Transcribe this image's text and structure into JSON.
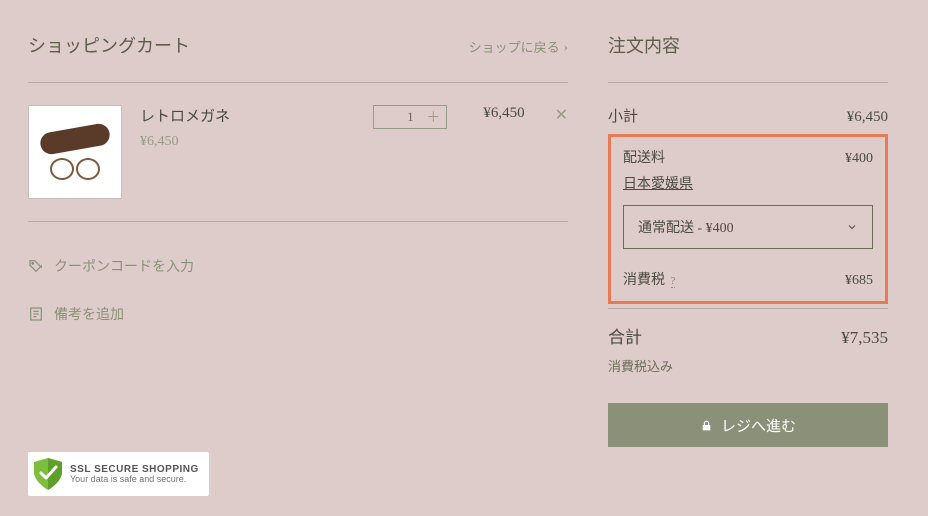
{
  "header": {
    "cart_title": "ショッピングカート",
    "back_to_shop": "ショップに戻る"
  },
  "item": {
    "name": "レトロメガネ",
    "unit_price": "¥6,450",
    "qty": "1",
    "line_total": "¥6,450"
  },
  "actions": {
    "coupon": "クーポンコードを入力",
    "note": "備考を追加"
  },
  "order": {
    "title": "注文内容",
    "subtotal_label": "小計",
    "subtotal_value": "¥6,450",
    "shipping_label": "配送料",
    "shipping_value": "¥400",
    "destination": "日本愛媛県",
    "shipping_option": "通常配送 - ¥400",
    "tax_label": "消費税",
    "tax_help": "?",
    "tax_value": "¥685",
    "total_label": "合計",
    "total_value": "¥7,535",
    "tax_note": "消費税込み",
    "checkout": "レジへ進む"
  },
  "ssl": {
    "line1_prefix": "SSL",
    "line1_main": "SECURE SHOPPING",
    "line2": "Your data is safe and secure."
  }
}
